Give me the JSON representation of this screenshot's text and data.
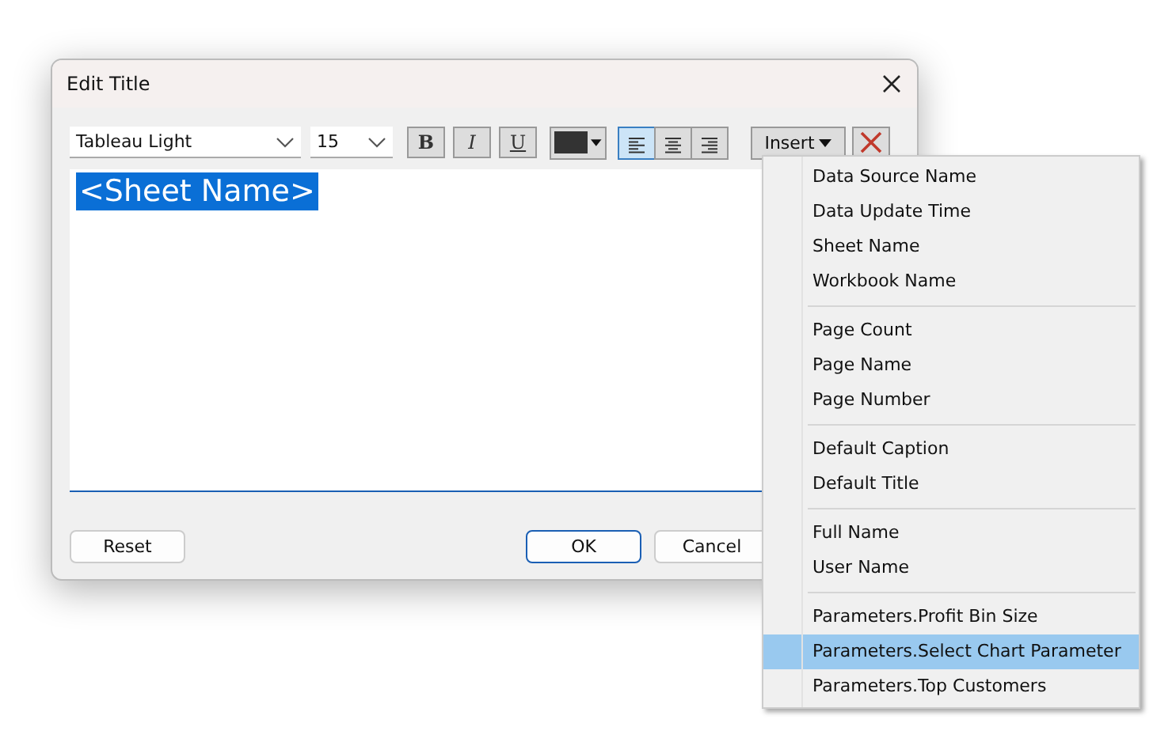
{
  "window": {
    "title": "Edit Title"
  },
  "toolbar": {
    "font": "Tableau Light",
    "size": "15",
    "styles": [
      {
        "label": "B",
        "kind": "bold",
        "on": false
      },
      {
        "label": "I",
        "kind": "italic",
        "on": false
      },
      {
        "label": "U",
        "kind": "underline",
        "on": false
      }
    ],
    "align": [
      {
        "kind": "left",
        "selected": true
      },
      {
        "kind": "center",
        "selected": false
      },
      {
        "kind": "right",
        "selected": false
      }
    ],
    "insert_button": "Insert"
  },
  "editor": {
    "text": "<Sheet Name>",
    "selected": true
  },
  "buttons": {
    "reset": "Reset",
    "ok": "OK",
    "cancel": "Cancel"
  },
  "insert_menu": [
    {
      "items": [
        {
          "label": "Data Source Name",
          "selected": false
        },
        {
          "label": "Data Update Time",
          "selected": false
        },
        {
          "label": "Sheet Name",
          "selected": false
        },
        {
          "label": "Workbook Name",
          "selected": false
        }
      ]
    },
    {
      "items": [
        {
          "label": "Page Count",
          "selected": false
        },
        {
          "label": "Page Name",
          "selected": false
        },
        {
          "label": "Page Number",
          "selected": false
        }
      ]
    },
    {
      "items": [
        {
          "label": "Default Caption",
          "selected": false
        },
        {
          "label": "Default Title",
          "selected": false
        }
      ]
    },
    {
      "items": [
        {
          "label": "Full Name",
          "selected": false
        },
        {
          "label": "User Name",
          "selected": false
        }
      ]
    },
    {
      "items": [
        {
          "label": "Parameters.Profit Bin Size",
          "selected": false
        },
        {
          "label": "Parameters.Select Chart Parameter",
          "selected": true
        },
        {
          "label": "Parameters.Top Customers",
          "selected": false
        }
      ]
    }
  ]
}
